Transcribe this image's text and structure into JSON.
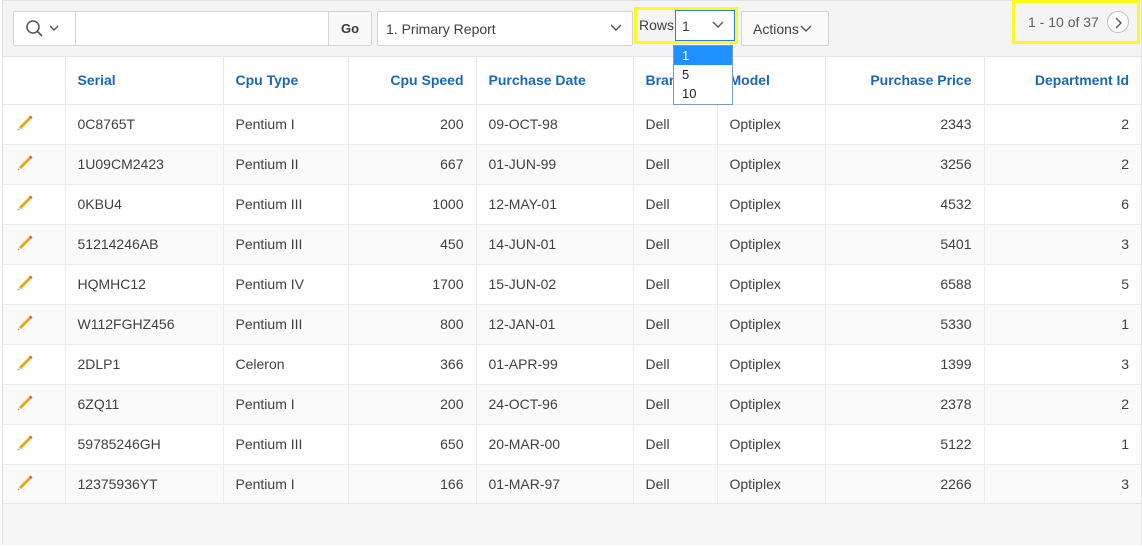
{
  "toolbar": {
    "search": {
      "value": "",
      "placeholder": "",
      "go_label": "Go"
    },
    "report": {
      "selected": "1. Primary Report"
    },
    "rows": {
      "label": "Rows",
      "selected": "1",
      "options": [
        "1",
        "5",
        "10"
      ]
    },
    "actions_label": "Actions"
  },
  "table": {
    "columns": [
      "",
      "Serial",
      "Cpu Type",
      "Cpu Speed",
      "Purchase Date",
      "Brand",
      "Model",
      "Purchase Price",
      "Department Id"
    ],
    "rows": [
      [
        "0C8765T",
        "Pentium I",
        "200",
        "09-OCT-98",
        "Dell",
        "Optiplex",
        "2343",
        "2"
      ],
      [
        "1U09CM2423",
        "Pentium II",
        "667",
        "01-JUN-99",
        "Dell",
        "Optiplex",
        "3256",
        "2"
      ],
      [
        "0KBU4",
        "Pentium III",
        "1000",
        "12-MAY-01",
        "Dell",
        "Optiplex",
        "4532",
        "6"
      ],
      [
        "51214246AB",
        "Pentium III",
        "450",
        "14-JUN-01",
        "Dell",
        "Optiplex",
        "5401",
        "3"
      ],
      [
        "HQMHC12",
        "Pentium IV",
        "1700",
        "15-JUN-02",
        "Dell",
        "Optiplex",
        "6588",
        "5"
      ],
      [
        "W112FGHZ456",
        "Pentium III",
        "800",
        "12-JAN-01",
        "Dell",
        "Optiplex",
        "5330",
        "1"
      ],
      [
        "2DLP1",
        "Celeron",
        "366",
        "01-APR-99",
        "Dell",
        "Optiplex",
        "1399",
        "3"
      ],
      [
        "6ZQ11",
        "Pentium I",
        "200",
        "24-OCT-96",
        "Dell",
        "Optiplex",
        "2378",
        "2"
      ],
      [
        "59785246GH",
        "Pentium III",
        "650",
        "20-MAR-00",
        "Dell",
        "Optiplex",
        "5122",
        "1"
      ],
      [
        "12375936YT",
        "Pentium I",
        "166",
        "01-MAR-97",
        "Dell",
        "Optiplex",
        "2266",
        "3"
      ]
    ]
  },
  "pagination": {
    "text": "1 - 10 of 37"
  },
  "colors": {
    "header_link": "#1a67b3",
    "highlight": "#fbfb21",
    "selected_option": "#1e90ff",
    "pencil": "#f0a30a"
  }
}
